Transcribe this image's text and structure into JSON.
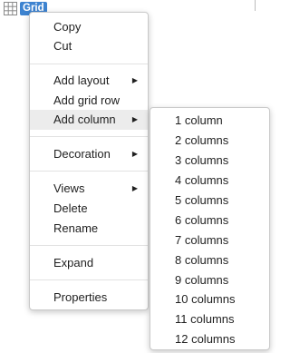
{
  "anchor": {
    "label": "Grid",
    "icon": "grid-icon"
  },
  "context_menu": {
    "items": [
      {
        "label": "Copy"
      },
      {
        "label": "Cut"
      },
      {
        "label": "Add layout",
        "submenu_icon": "chevron-right-icon"
      },
      {
        "label": "Add grid row"
      },
      {
        "label": "Add column",
        "submenu_icon": "chevron-right-icon",
        "highlighted": true
      },
      {
        "label": "Decoration",
        "submenu_icon": "chevron-right-icon"
      },
      {
        "label": "Views",
        "submenu_icon": "chevron-right-icon"
      },
      {
        "label": "Delete"
      },
      {
        "label": "Rename"
      },
      {
        "label": "Expand"
      },
      {
        "label": "Properties"
      }
    ]
  },
  "submenu": {
    "items": [
      {
        "label": "1 column"
      },
      {
        "label": "2 columns"
      },
      {
        "label": "3 columns"
      },
      {
        "label": "4 columns"
      },
      {
        "label": "5 columns"
      },
      {
        "label": "6 columns"
      },
      {
        "label": "7 columns"
      },
      {
        "label": "8 columns"
      },
      {
        "label": "9 columns"
      },
      {
        "label": "10 columns"
      },
      {
        "label": "11 columns"
      },
      {
        "label": "12 columns"
      }
    ]
  },
  "colors": {
    "chip_background": "#3d83d0",
    "highlight_background": "#ececec"
  }
}
